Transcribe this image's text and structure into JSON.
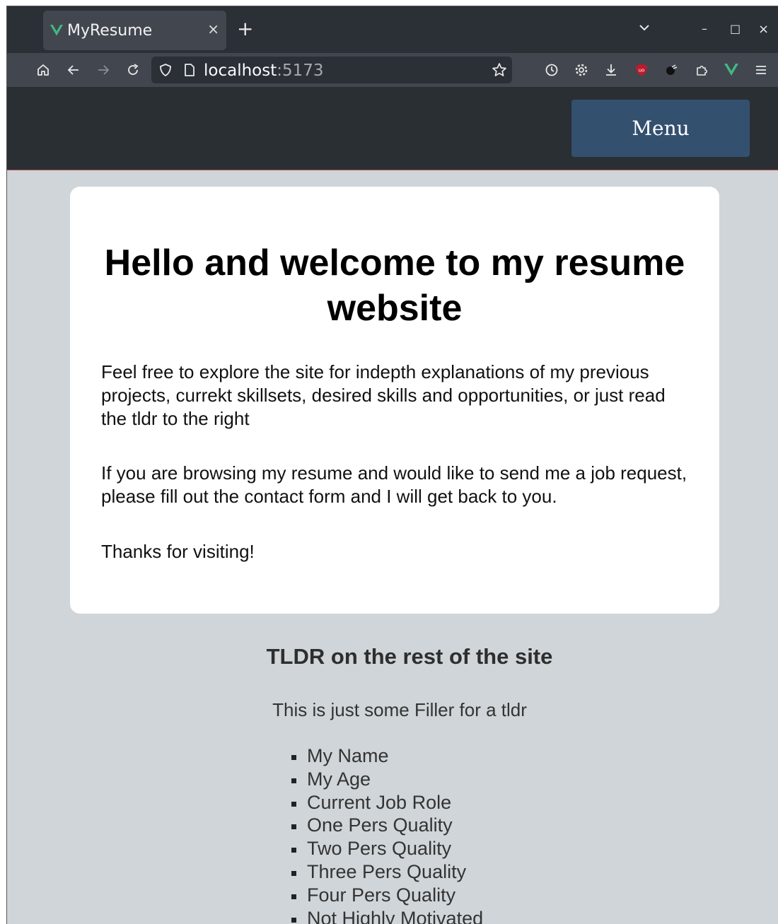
{
  "browser": {
    "tab_title": "MyResume",
    "tab_close": "×",
    "new_tab": "+",
    "url_host": "localhost",
    "url_port": ":5173",
    "window_minimize": "–",
    "window_maximize": "□",
    "window_close": "×",
    "icons": [
      "home-icon",
      "back-icon",
      "forward-icon",
      "reload-icon",
      "shield-icon",
      "page-icon",
      "bookmark-star-icon",
      "history-icon",
      "settings-icon",
      "downloads-icon",
      "ublock-icon",
      "extension-icon",
      "extensions-puzzle-icon",
      "vue-devtools-icon",
      "hamburger-menu-icon"
    ],
    "accent_color": "#41b883"
  },
  "header": {
    "menu_label": "Menu",
    "menu_color": "#34506f"
  },
  "card": {
    "title": "Hello and welcome to my resume website",
    "p1": "Feel free to explore the site for indepth explanations of my previous projects, currekt skillsets, desired skills and opportunities, or just read the tldr to the right",
    "p2": "If you are browsing my resume and would like to send me a job request, please fill out the contact form and I will get back to you.",
    "p3": "Thanks for visiting!"
  },
  "tldr": {
    "title": "TLDR on the rest of the site",
    "subtitle": "This is just some Filler for a tldr",
    "items": [
      "My Name",
      "My Age",
      "Current Job Role",
      "One Pers Quality",
      "Two Pers Quality",
      "Three Pers Quality",
      "Four Pers Quality",
      "Not Highly Motivated"
    ]
  }
}
